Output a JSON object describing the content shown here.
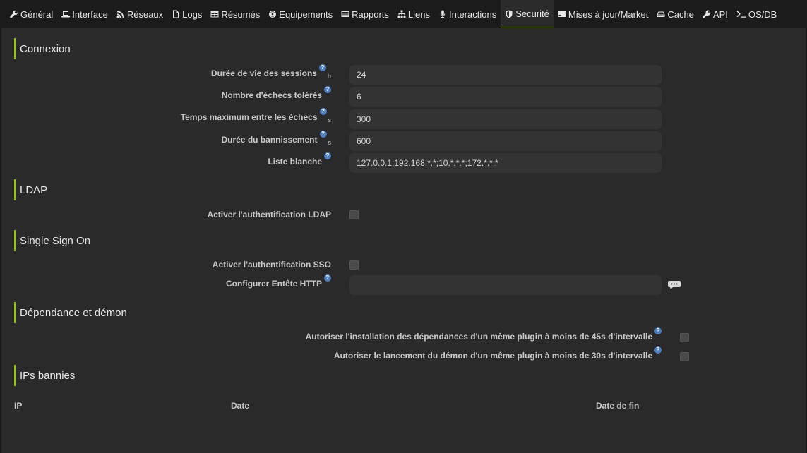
{
  "tabs": [
    {
      "label": "Général",
      "icon": "wrench-icon"
    },
    {
      "label": "Interface",
      "icon": "laptop-icon"
    },
    {
      "label": "Réseaux",
      "icon": "rss-icon"
    },
    {
      "label": "Logs",
      "icon": "file-icon"
    },
    {
      "label": "Résumés",
      "icon": "table-icon"
    },
    {
      "label": "Equipements",
      "icon": "eye-icon"
    },
    {
      "label": "Rapports",
      "icon": "list-icon"
    },
    {
      "label": "Liens",
      "icon": "sitemap-icon"
    },
    {
      "label": "Interactions",
      "icon": "microphone-icon"
    },
    {
      "label": "Securité",
      "icon": "shield-icon",
      "active": true
    },
    {
      "label": "Mises à jour/Market",
      "icon": "credit-card-icon"
    },
    {
      "label": "Cache",
      "icon": "hdd-icon"
    },
    {
      "label": "API",
      "icon": "key-icon"
    },
    {
      "label": "OS/DB",
      "icon": "terminal-icon"
    }
  ],
  "accent_color": "#94ca02",
  "help_glyph": "?",
  "connexion": {
    "title": "Connexion",
    "session_label": "Durée de vie des sessions",
    "session_unit": "h",
    "session_value": "24",
    "fails_label": "Nombre d'échecs tolérés",
    "fails_value": "6",
    "max_time_label": "Temps maximum entre les échecs",
    "max_time_unit": "s",
    "max_time_value": "300",
    "ban_label": "Durée du bannissement",
    "ban_unit": "s",
    "ban_value": "600",
    "whitelist_label": "Liste blanche",
    "whitelist_value": "127.0.0.1;192.168.*.*;10.*.*.*;172.*.*.*"
  },
  "ldap": {
    "title": "LDAP",
    "enable_label": "Activer l'authentification LDAP"
  },
  "sso": {
    "title": "Single Sign On",
    "enable_label": "Activer l'authentification SSO",
    "header_label": "Configurer Entête HTTP",
    "header_value": ""
  },
  "deps": {
    "title": "Dépendance et démon",
    "install_label": "Autoriser l'installation des dépendances d'un même plugin à moins de 45s d'intervalle",
    "daemon_label": "Autoriser le lancement du démon d'un même plugin à moins de 30s d'intervalle"
  },
  "banned": {
    "title": "IPs bannies",
    "columns": [
      "IP",
      "Date",
      "Date de fin"
    ]
  }
}
